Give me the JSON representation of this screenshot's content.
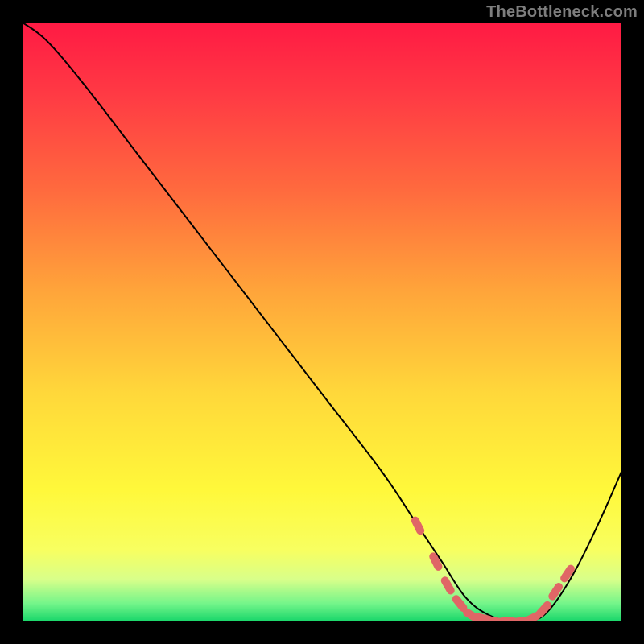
{
  "watermark": "TheBottleneck.com",
  "chart_data": {
    "type": "line",
    "title": "",
    "xlabel": "",
    "ylabel": "",
    "xlim": [
      0,
      100
    ],
    "ylim": [
      0,
      100
    ],
    "grid": false,
    "legend": false,
    "series": [
      {
        "name": "curve",
        "x": [
          0,
          4,
          10,
          20,
          30,
          40,
          50,
          60,
          66,
          70,
          74,
          78,
          82,
          85,
          88,
          92,
          96,
          100
        ],
        "y": [
          100,
          97,
          90,
          77,
          64,
          51,
          38,
          25,
          16,
          10,
          4,
          1,
          0,
          0,
          2,
          8,
          16,
          25
        ],
        "stroke": "#000000",
        "stroke_width": 2
      }
    ],
    "markers": {
      "name": "red-dashes",
      "color": "#e06666",
      "points": [
        {
          "x": 66,
          "y": 16
        },
        {
          "x": 69,
          "y": 10
        },
        {
          "x": 71,
          "y": 6
        },
        {
          "x": 73,
          "y": 3
        },
        {
          "x": 75,
          "y": 1
        },
        {
          "x": 77,
          "y": 0.5
        },
        {
          "x": 79,
          "y": 0
        },
        {
          "x": 81,
          "y": 0
        },
        {
          "x": 83,
          "y": 0
        },
        {
          "x": 85,
          "y": 0.5
        },
        {
          "x": 87,
          "y": 2
        },
        {
          "x": 89,
          "y": 5
        },
        {
          "x": 91,
          "y": 8
        }
      ]
    },
    "background_gradient": {
      "stops": [
        {
          "offset": 0.0,
          "color": "#ff1a44"
        },
        {
          "offset": 0.12,
          "color": "#ff3a44"
        },
        {
          "offset": 0.28,
          "color": "#ff6a3e"
        },
        {
          "offset": 0.45,
          "color": "#ffa53a"
        },
        {
          "offset": 0.62,
          "color": "#ffd83a"
        },
        {
          "offset": 0.78,
          "color": "#fff83a"
        },
        {
          "offset": 0.88,
          "color": "#f8ff60"
        },
        {
          "offset": 0.93,
          "color": "#d8ff8a"
        },
        {
          "offset": 0.97,
          "color": "#74f58a"
        },
        {
          "offset": 1.0,
          "color": "#18d66a"
        }
      ]
    }
  }
}
